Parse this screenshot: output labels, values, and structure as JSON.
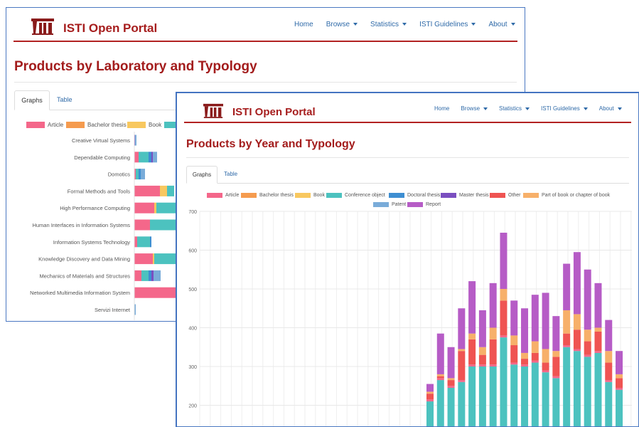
{
  "colors": {
    "article": "#f4678a",
    "bachelor": "#f59b4f",
    "book": "#f8c85f",
    "conference": "#4cc2bf",
    "doctoral": "#3e8ed2",
    "master": "#7a4fc0",
    "other": "#ef5452",
    "part_of_book": "#f7b06a",
    "patent": "#7aacd9",
    "report": "#b65cc6",
    "brand": "#a61d1d",
    "link": "#2f6aa8"
  },
  "portal": {
    "brand": "ISTI Open Portal",
    "nav": [
      "Home",
      "Browse",
      "Statistics",
      "ISTI Guidelines",
      "About"
    ]
  },
  "back_window": {
    "title": "Products by Laboratory and Typology",
    "tabs": [
      "Graphs",
      "Table"
    ],
    "legend": [
      "Article",
      "Bachelor thesis",
      "Book"
    ],
    "labs": [
      "Creative Virtual Systems",
      "Dependable Computing",
      "Domotics",
      "Formal Methods and Tools",
      "High Performance Computing",
      "Human Interfaces in Information Systems",
      "Information Systems Technology",
      "Knowledge Discovery and Data Mining",
      "Mechanics of Materials and Structures",
      "Networked Multimedia Information System",
      "Servizi Internet"
    ]
  },
  "front_window": {
    "title": "Products by Year and Typology",
    "tabs": [
      "Graphs",
      "Table"
    ],
    "legend": [
      "Article",
      "Bachelor thesis",
      "Book",
      "Conference object",
      "Doctoral thesis",
      "Master thesis",
      "Other",
      "Part of book or chapter of book",
      "Patent",
      "Report"
    ]
  },
  "chart_data": [
    {
      "type": "bar",
      "orientation": "horizontal",
      "stacked": true,
      "title": "Products by Laboratory and Typology",
      "categories": [
        "Creative Virtual Systems",
        "Dependable Computing",
        "Domotics",
        "Formal Methods and Tools",
        "High Performance Computing",
        "Human Interfaces in Information Systems",
        "Information Systems Technology",
        "Knowledge Discovery and Data Mining",
        "Mechanics of Materials and Structures",
        "Networked Multimedia Information System",
        "Servizi Internet"
      ],
      "series": [
        {
          "name": "Article",
          "values": [
            0,
            6,
            2,
            36,
            28,
            22,
            4,
            26,
            10,
            70,
            0
          ]
        },
        {
          "name": "Book",
          "values": [
            0,
            0,
            0,
            10,
            3,
            0,
            0,
            2,
            0,
            0,
            0
          ]
        },
        {
          "name": "Conference object",
          "values": [
            0,
            14,
            4,
            10,
            40,
            50,
            18,
            48,
            10,
            0,
            0
          ]
        },
        {
          "name": "Doctoral thesis",
          "values": [
            0,
            4,
            3,
            0,
            0,
            0,
            2,
            0,
            4,
            0,
            0
          ]
        },
        {
          "name": "Master thesis",
          "values": [
            1,
            2,
            0,
            0,
            0,
            0,
            0,
            0,
            3,
            0,
            0
          ]
        },
        {
          "name": "Patent",
          "values": [
            2,
            6,
            6,
            0,
            0,
            0,
            0,
            0,
            10,
            0,
            2
          ]
        }
      ]
    },
    {
      "type": "bar",
      "stacked": true,
      "title": "Products by Year and Typology",
      "ylim": [
        180,
        700
      ],
      "yticks": [
        200,
        300,
        400,
        500,
        600,
        700
      ],
      "series": [
        {
          "name": "Conference object",
          "values": [
            210,
            265,
            245,
            260,
            300,
            300,
            300,
            375,
            305,
            300,
            310,
            285,
            270,
            350,
            340,
            325,
            335,
            260,
            240
          ]
        },
        {
          "name": "Article",
          "values": [
            5,
            5,
            5,
            5,
            5,
            5,
            5,
            5,
            5,
            5,
            5,
            5,
            5,
            5,
            5,
            5,
            5,
            5,
            5
          ]
        },
        {
          "name": "Other",
          "values": [
            15,
            5,
            15,
            75,
            65,
            25,
            65,
            90,
            45,
            15,
            20,
            20,
            50,
            30,
            50,
            35,
            50,
            45,
            25
          ]
        },
        {
          "name": "Part of book or chapter of book",
          "values": [
            5,
            5,
            5,
            5,
            15,
            20,
            30,
            30,
            25,
            15,
            30,
            35,
            15,
            60,
            40,
            30,
            10,
            30,
            10
          ]
        },
        {
          "name": "Report",
          "values": [
            20,
            105,
            80,
            105,
            135,
            95,
            115,
            145,
            90,
            115,
            120,
            145,
            90,
            120,
            160,
            155,
            115,
            80,
            60
          ]
        }
      ]
    }
  ]
}
